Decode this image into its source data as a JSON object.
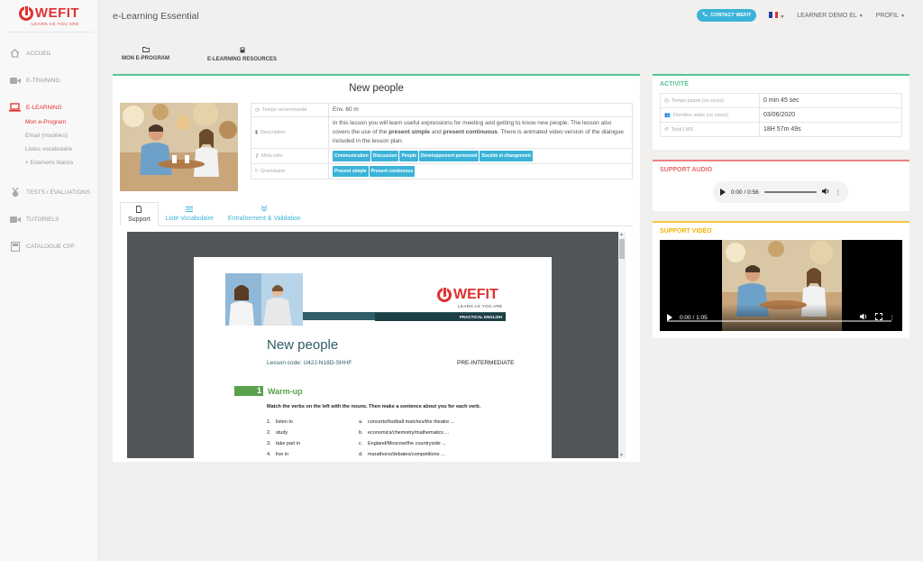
{
  "brand": {
    "name": "WEFIT",
    "tagline": "LEARN AS YOU ARE",
    "color": "#e03131"
  },
  "app_title": "e-Learning Essential",
  "topbar": {
    "contact_label": "CONTACT WEFIT",
    "language_icon": "french-flag-icon",
    "user_label": "LEARNER DEMO EL",
    "profile_label": "PROFIL"
  },
  "sidebar": {
    "items": [
      {
        "label": "ACCUEIL",
        "icon": "home-icon"
      },
      {
        "label": "E-TRAINING",
        "icon": "video-camera-icon"
      },
      {
        "label": "E-LEARNING",
        "icon": "laptop-icon"
      },
      {
        "label": "TESTS / ÉVALUATIONS",
        "icon": "medal-icon"
      },
      {
        "label": "TUTORIELS",
        "icon": "video-camera-icon"
      },
      {
        "label": "CATALOGUE CPF",
        "icon": "book-icon"
      }
    ],
    "sub_items": [
      "Mon e-Program",
      "Email (modèles)",
      "Listes vocabulaire",
      "+ Examens blancs"
    ]
  },
  "tabs": [
    {
      "label": "MON E-PROGRAM",
      "icon": "folder-icon"
    },
    {
      "label": "E-LEARNING RESOURCES",
      "icon": "book-icon"
    }
  ],
  "lesson": {
    "title": "New people",
    "rows": [
      {
        "key": "Temps recommandé",
        "icon": "clock-icon",
        "value": "Env. 60 m"
      },
      {
        "key": "Description",
        "icon": "book-icon",
        "desc_prefix": "In this lesson you will learn useful expressions for meeting and getting to know new people. The lesson also covers the use of the ",
        "desc_bold1": "present simple",
        "desc_and": " and ",
        "desc_bold2": "present continuous",
        "desc_suffix": ". There is animated video version of the dialogue included in the lesson plan."
      },
      {
        "key": "Mots-clés",
        "icon": "key-icon",
        "tags": [
          "Communication",
          "Discussion",
          "People",
          "Développement personnel",
          "Société et changement"
        ]
      },
      {
        "key": "Grammaire",
        "icon": "bookmark-icon",
        "tags": [
          "Present simple",
          "Present continuous"
        ]
      }
    ],
    "tabs": [
      {
        "label": "Support",
        "icon": "document-icon"
      },
      {
        "label": "Liste Vocabulaire",
        "icon": "list-icon"
      },
      {
        "label": "Entraînement & Validation",
        "icon": "double-chevron-down-icon"
      }
    ]
  },
  "document": {
    "brand": "WEFIT",
    "tagline": "LEARN AS YOU ARE",
    "banner": "PRACTICAL ENGLISH",
    "title": "New people",
    "code": "Lesson code: U42J-N18D-SHHF",
    "level": "PRE-INTERMEDIATE",
    "section_num": "1",
    "section_title": "Warm-up",
    "instruction": "Match the verbs on the left with the nouns. Then make a sentence about you for each verb.",
    "verbs": [
      {
        "n": "1.",
        "t": "listen to"
      },
      {
        "n": "2.",
        "t": "study"
      },
      {
        "n": "3.",
        "t": "take part in"
      },
      {
        "n": "4.",
        "t": "live in"
      }
    ],
    "nouns": [
      {
        "n": "a.",
        "t": "concerts/football matches/the theatre ..."
      },
      {
        "n": "b.",
        "t": "economics/chemistry/mathematics ..."
      },
      {
        "n": "c.",
        "t": "England/Moscow/the countryside ..."
      },
      {
        "n": "d.",
        "t": "marathons/debates/competitions ..."
      }
    ]
  },
  "activity": {
    "title": "ACTIVITÉ",
    "rows": [
      {
        "key": "Temps passé (ce cours)",
        "icon": "clock-icon",
        "value": "0 min 45 sec"
      },
      {
        "key": "Dernière visite (ce cours)",
        "icon": "users-icon",
        "value": "03/06/2020"
      },
      {
        "key": "Total LMS",
        "icon": "history-icon",
        "value": "18H 57m 49s"
      }
    ]
  },
  "audio": {
    "title": "SUPPORT AUDIO",
    "time": "0:00 / 0:56"
  },
  "video": {
    "title": "SUPPORT VIDÉO",
    "time": "0:00 / 1:05"
  },
  "colors": {
    "accent_blue": "#3bb3d9",
    "green": "#56c596",
    "red": "#e36b6b",
    "yellow": "#f5b400"
  }
}
